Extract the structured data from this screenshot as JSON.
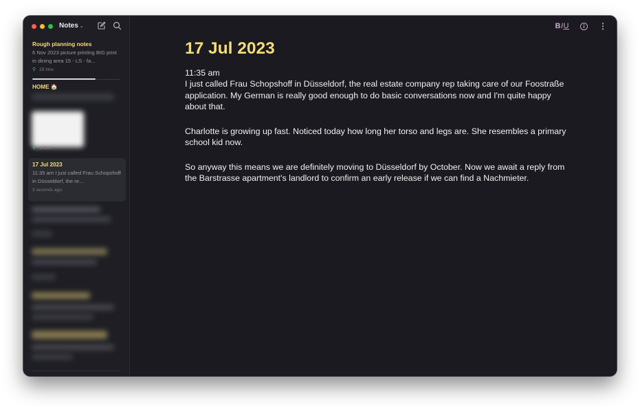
{
  "sidebar": {
    "folder_title": "Notes",
    "notes": [
      {
        "title": "Rough planning notes",
        "snippet": "6 Nov 2023 picture printing BIG print in dining area 15 - LS - fa...",
        "date": "29 Nov"
      },
      {
        "title": "HOME 🏠",
        "date": "1 Nov"
      },
      {
        "title": "17 Jul 2023",
        "snippet": "11:35 am I just called Frau Schopshoff in Düsseldorf, the re...",
        "date": "3 seconds ago"
      }
    ]
  },
  "toolbar": {
    "format_bold": "B",
    "format_italic": "I",
    "format_underline": "U",
    "info": "i",
    "more": "⋮"
  },
  "editor": {
    "title": "17 Jul 2023",
    "paragraphs": [
      "11:35 am\nI just called Frau Schopshoff in Düsseldorf, the real estate company rep taking care of our Foostraße application. My German is really good enough to do basic conversations now and I'm quite happy about that.",
      "Charlotte is growing up fast. Noticed today how long her torso and legs are. She resembles a primary school kid now.",
      "So anyway this means we are definitely moving to Düsseldorf by October. Now we await a reply from the Barstrasse apartment's landlord to confirm an early release if we can find a Nachmieter."
    ]
  },
  "colors": {
    "accent": "#f4dd7a",
    "toolbar_icon": "#c7a8c7",
    "background": "#1a1a20"
  }
}
